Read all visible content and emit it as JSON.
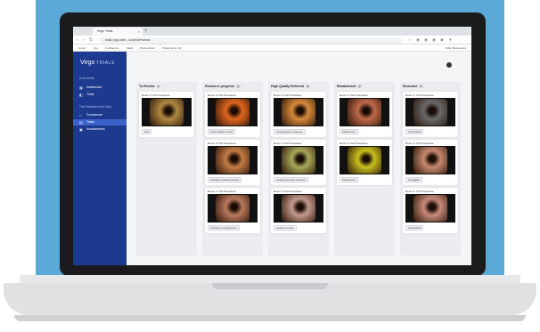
{
  "browser": {
    "tab_title": "Virgo Trials",
    "tab_close": "×",
    "new_tab": "+",
    "url": "trials.virgo.site/...column/reviews",
    "back": "‹",
    "forward": "›",
    "reload": "↻",
    "bookmarks": [
      "Gmail",
      "Jira",
      "Confluence",
      "Slack",
      "Portal Admin",
      "Portal Admin V2"
    ],
    "other_bookmarks": "Other Bookmarks"
  },
  "sidebar": {
    "logo": "Virgo",
    "logo_sub": "TRIALS",
    "section_user": "Hello Admin",
    "items_main": [
      {
        "icon": "▦",
        "label": "Dashboard"
      },
      {
        "icon": "◧",
        "label": "Trials"
      }
    ],
    "section_trial": "Trial Definitions And Data",
    "items_trial": [
      {
        "icon": "⌂",
        "label": "Procedures"
      },
      {
        "icon": "▤",
        "label": "Tasks"
      },
      {
        "icon": "▣",
        "label": "Assessments"
      }
    ]
  },
  "columns": [
    {
      "title": "To Review",
      "count": "1",
      "cards": [
        {
          "title": "Room 3: Full Procedure",
          "tag": "Start",
          "color": "#b08842"
        }
      ]
    },
    {
      "title": "Review in progress",
      "count": "3",
      "cards": [
        {
          "title": "Room 2: Full Procedure",
          "tag": "Check related content",
          "color": "#e0671e"
        },
        {
          "title": "Room 3: Full Procedure",
          "tag": "Providing confusing request",
          "color": "#c57c45"
        },
        {
          "title": "Room 1: Full Procedure",
          "tag": "Providing UX assessment",
          "color": "#b97a5e"
        }
      ]
    },
    {
      "title": "High Quality Referred",
      "count": "3",
      "cards": [
        {
          "title": "Room 2: Full Procedure",
          "tag": "Awaiting patient response",
          "color": "#d98a3a"
        },
        {
          "title": "Room 2: Full Procedure",
          "tag": "Awaiting physician response",
          "color": "#a8a85a"
        },
        {
          "title": "Room 2: Full Procedure",
          "tag": "Awaiting consent",
          "color": "#c49a8e"
        }
      ]
    },
    {
      "title": "Randomized",
      "count": "2",
      "cards": [
        {
          "title": "Room 2: Full Procedure",
          "tag": "Randomized",
          "color": "#c06a4a"
        },
        {
          "title": "Room 2: Full Procedure",
          "tag": "Randomized",
          "color": "#c9c01e"
        }
      ]
    },
    {
      "title": "Excluded",
      "count": "3",
      "cards": [
        {
          "title": "Room 1: Full Procedure",
          "tag": "Not Enrolled",
          "color": "#6a6a6a"
        },
        {
          "title": "Room 2: Full Procedure",
          "tag": "Not Eligible",
          "color": "#c98a70"
        },
        {
          "title": "Room 1: Full Procedure",
          "tag": "Not Enrolled",
          "color": "#c88b7a"
        }
      ]
    }
  ]
}
